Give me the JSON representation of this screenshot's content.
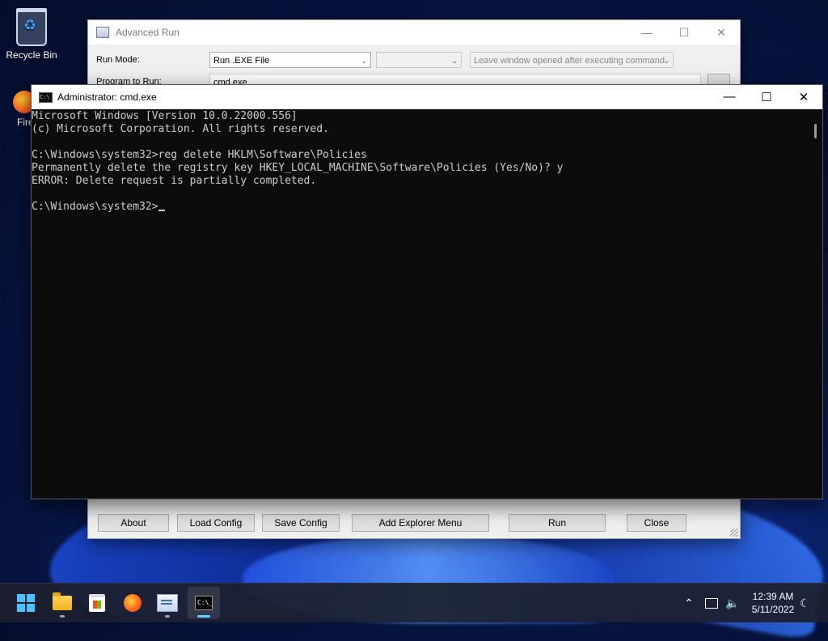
{
  "desktop": {
    "recycle_bin_label": "Recycle Bin",
    "firefox_label": "Fire"
  },
  "advanced_run": {
    "title": "Advanced Run",
    "run_mode_label": "Run Mode:",
    "run_mode_value": "Run .EXE File",
    "second_combo_value": "",
    "window_option_value": "Leave window opened after executing command",
    "program_label": "Program to Run:",
    "program_value": "cmd.exe",
    "buttons": {
      "about": "About",
      "load_config": "Load Config",
      "save_config": "Save Config",
      "add_explorer_menu": "Add Explorer Menu",
      "run": "Run",
      "close": "Close"
    }
  },
  "cmd": {
    "title": "Administrator: cmd.exe",
    "lines": [
      "Microsoft Windows [Version 10.0.22000.556]",
      "(c) Microsoft Corporation. All rights reserved.",
      "",
      "C:\\Windows\\system32>reg delete HKLM\\Software\\Policies",
      "Permanently delete the registry key HKEY_LOCAL_MACHINE\\Software\\Policies (Yes/No)? y",
      "ERROR: Delete request is partially completed.",
      ""
    ],
    "prompt": "C:\\Windows\\system32>"
  },
  "taskbar": {
    "apps": [
      "start-icon",
      "file-explorer-icon",
      "store-icon",
      "firefox-icon",
      "advanced-run-icon",
      "terminal-icon"
    ],
    "time": "12:39 AM",
    "date": "5/11/2022"
  }
}
